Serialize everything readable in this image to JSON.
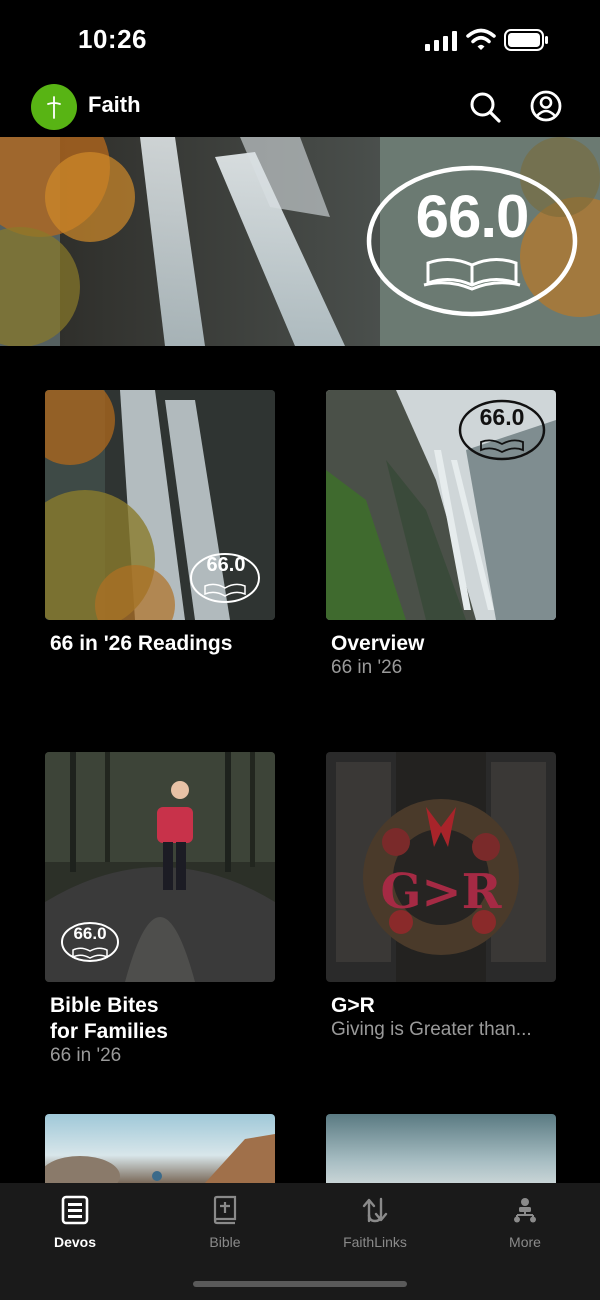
{
  "status_bar": {
    "time": "10:26",
    "icons": [
      "signal-icon",
      "wifi-icon",
      "battery-icon"
    ]
  },
  "header": {
    "app_name": "Faith",
    "logo_icon": "cross-icon",
    "logo_color": "#58b414",
    "actions": [
      "search-icon",
      "profile-icon"
    ]
  },
  "hero": {
    "badge_text": "66.0",
    "badge_icon": "open-book-icon"
  },
  "cards": [
    {
      "title": "66 in '26 Readings",
      "subtitle": "",
      "badge_text": "66.0"
    },
    {
      "title": "Overview",
      "subtitle": "66 in '26",
      "badge_text": "66.0"
    },
    {
      "title_line1": "Bible Bites",
      "title_line2": "for Families",
      "subtitle": "66 in '26",
      "badge_text": "66.0"
    },
    {
      "title": "G>R",
      "subtitle": "Giving is Greater than...",
      "art_text": "G>R"
    }
  ],
  "tab_bar": {
    "tabs": [
      {
        "label": "Devos",
        "icon": "devos-icon",
        "active": true
      },
      {
        "label": "Bible",
        "icon": "bible-icon",
        "active": false
      },
      {
        "label": "FaithLinks",
        "icon": "faithlinks-icon",
        "active": false
      },
      {
        "label": "More",
        "icon": "more-icon",
        "active": false
      }
    ]
  }
}
